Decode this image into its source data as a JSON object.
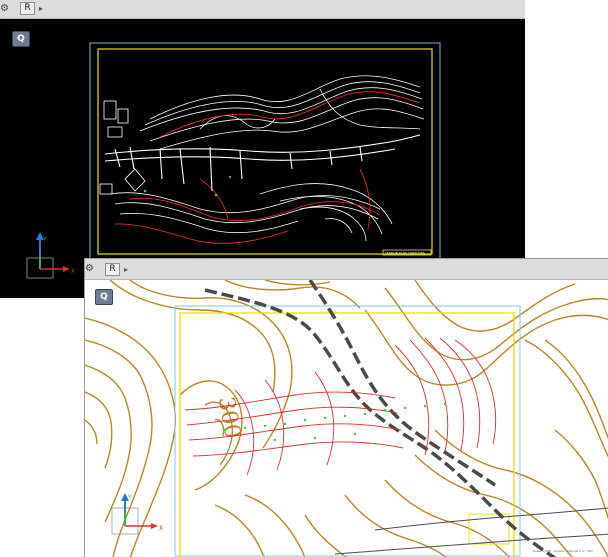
{
  "window_back": {
    "toolbar": {
      "gear_icon": "gear-icon",
      "layout_button_label": "R",
      "arrow_icon": "chevron-right-icon"
    },
    "canvas": {
      "background": "#000000",
      "badge_label": "Q",
      "axis": {
        "x_label": "X",
        "y_label": "Y"
      },
      "title_block_text": "TERRAIN PLAN CONTOURS"
    }
  },
  "window_front": {
    "toolbar": {
      "gear_icon": "gear-icon",
      "layout_button_label": "R",
      "arrow_icon": "chevron-right-icon"
    },
    "canvas": {
      "background": "#ffffff",
      "badge_label": "Q",
      "contour_label": "300",
      "axis": {
        "x_label": "X",
        "y_label": "Y"
      },
      "footer_text": "Scale 1:500 · Contour interval 1 m · ISO"
    }
  },
  "colors": {
    "frame_yellow": "#e8e000",
    "frame_blue": "#4aa8d8",
    "contour_tan": "#b8862a",
    "contour_red": "#d83030",
    "road_gray": "#4a4a4a",
    "points_green": "#30d040"
  }
}
